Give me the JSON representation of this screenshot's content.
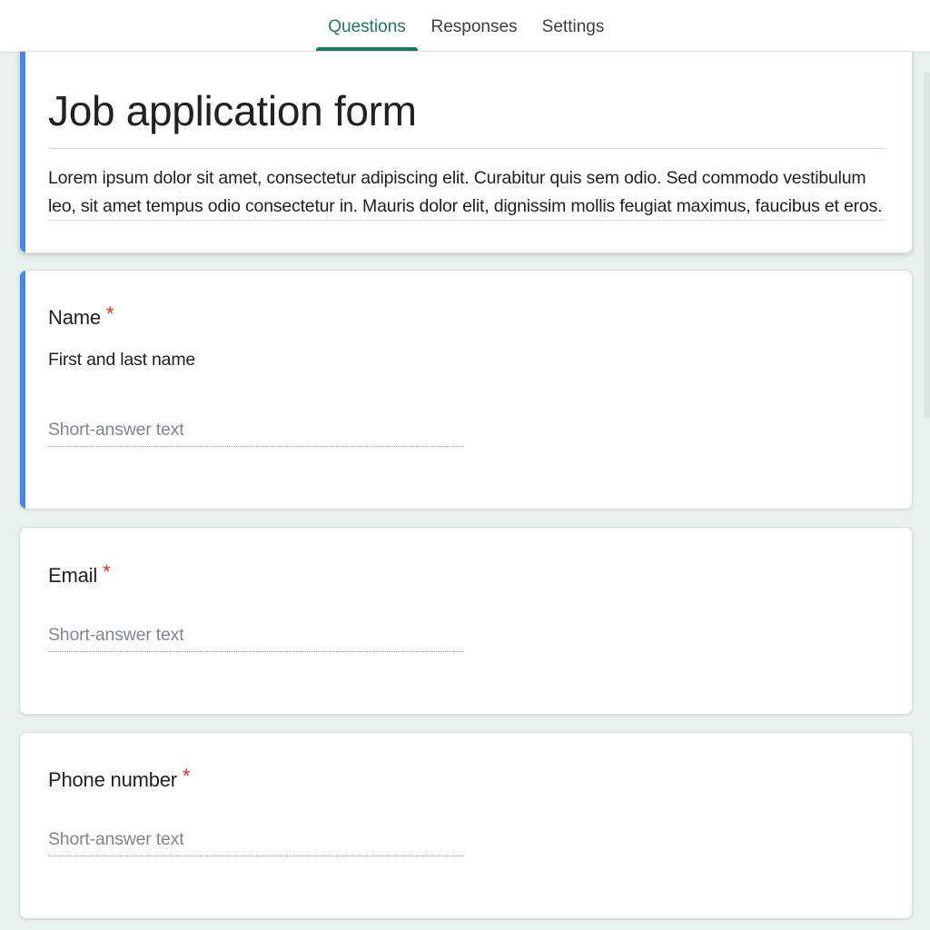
{
  "tabs": [
    {
      "label": "Questions",
      "active": true
    },
    {
      "label": "Responses",
      "active": false
    },
    {
      "label": "Settings",
      "active": false
    }
  ],
  "colors": {
    "accent": "#1f7a63",
    "selected_card_bar": "#4a86e8",
    "required": "#d93025",
    "page_background": "#e9f1ef"
  },
  "form": {
    "title": "Job application form",
    "description": "Lorem ipsum dolor sit amet, consectetur adipiscing elit. Curabitur quis sem odio. Sed commodo vestibulum leo, sit amet tempus odio consectetur in. Mauris dolor elit, dignissim mollis feugiat maximus, faucibus et eros."
  },
  "questions": [
    {
      "title": "Name",
      "required_mark": "*",
      "description": "First and last name",
      "answer_placeholder": "Short-answer text"
    },
    {
      "title": "Email",
      "required_mark": "*",
      "answer_placeholder": "Short-answer text"
    },
    {
      "title": "Phone number",
      "required_mark": "*",
      "answer_placeholder": "Short-answer text"
    }
  ]
}
